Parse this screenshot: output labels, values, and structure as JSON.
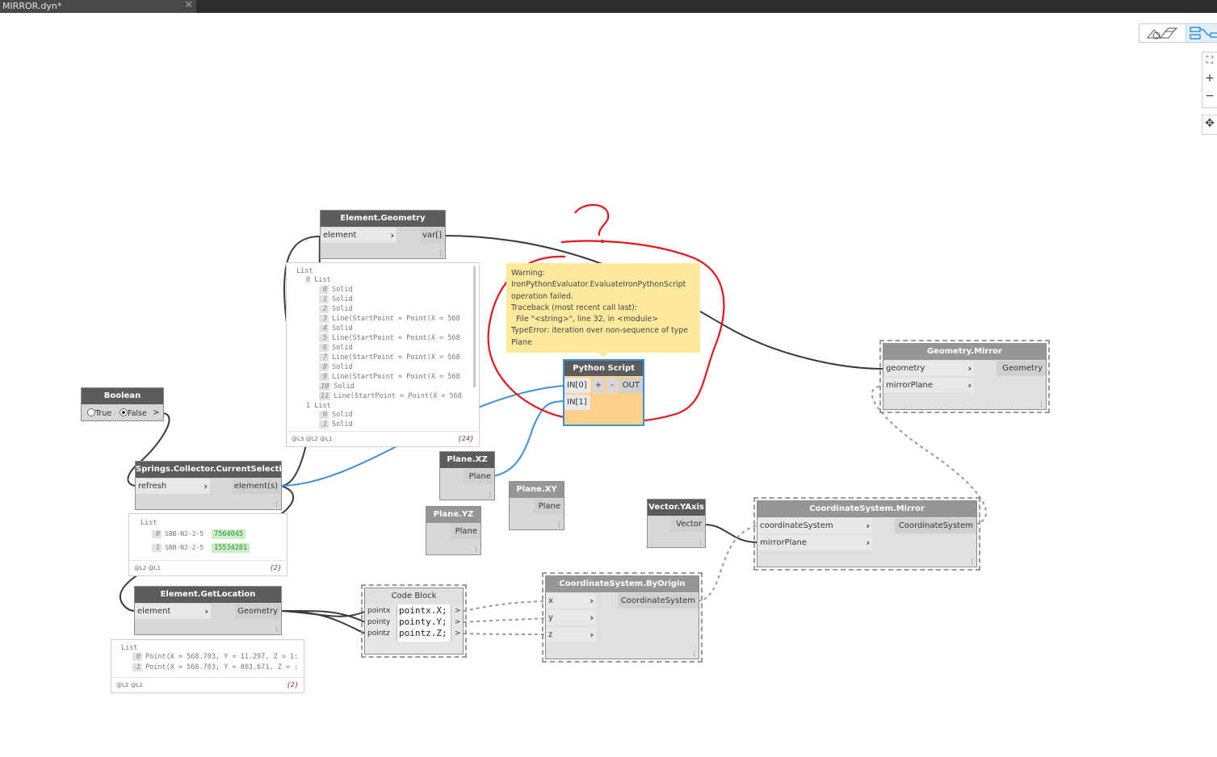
{
  "tab": {
    "title": "MIRROR.dyn*",
    "close": "✕"
  },
  "view_controls": {
    "nav": [
      "⛶",
      "+",
      "−",
      "✥"
    ]
  },
  "nodes": {
    "element_geometry": {
      "title": "Element.Geometry",
      "in": "element",
      "out": "var[]"
    },
    "boolean": {
      "title": "Boolean",
      "true_label": "True",
      "false_label": "False",
      "out": ">"
    },
    "current_selection": {
      "title": "Springs.Collector.CurrentSelection",
      "in": "refresh",
      "out": "element(s)"
    },
    "element_getlocation": {
      "title": "Element.GetLocation",
      "in": "element",
      "out": "Geometry"
    },
    "python_script": {
      "title": "Python Script",
      "in0": "IN[0]",
      "in1": "IN[1]",
      "plus": "+",
      "minus": "-",
      "out": "OUT"
    },
    "plane_xz": {
      "title": "Plane.XZ",
      "out": "Plane"
    },
    "plane_xy": {
      "title": "Plane.XY",
      "out": "Plane"
    },
    "plane_yz": {
      "title": "Plane.YZ",
      "out": "Plane"
    },
    "geometry_mirror": {
      "title": "Geometry.Mirror",
      "in0": "geometry",
      "in1": "mirrorPlane",
      "out": "Geometry"
    },
    "vector_yaxis": {
      "title": "Vector.YAxis",
      "out": "Vector"
    },
    "cs_mirror": {
      "title": "CoordinateSystem.Mirror",
      "in0": "coordinateSystem",
      "in1": "mirrorPlane",
      "out": "CoordinateSystem"
    },
    "code_block": {
      "title": "Code Block",
      "inputs": [
        "pointx",
        "pointy",
        "pointz"
      ],
      "lines": [
        "pointx.X;",
        "pointy.Y;",
        "pointz.Z;"
      ],
      "out": ">"
    },
    "cs_byorigin": {
      "title": "CoordinateSystem.ByOrigin",
      "inputs": [
        "x",
        "y",
        "z"
      ],
      "out": "CoordinateSystem"
    }
  },
  "previews": {
    "geometry": {
      "header": "List",
      "sub0": "0 List",
      "items": [
        {
          "i": "0",
          "v": "Solid"
        },
        {
          "i": "1",
          "v": "Solid"
        },
        {
          "i": "2",
          "v": "Solid"
        },
        {
          "i": "3",
          "v": "Line(StartPoint = Point(X = 568"
        },
        {
          "i": "4",
          "v": "Solid"
        },
        {
          "i": "5",
          "v": "Line(StartPoint = Point(X = 568"
        },
        {
          "i": "6",
          "v": "Solid"
        },
        {
          "i": "7",
          "v": "Line(StartPoint = Point(X = 568"
        },
        {
          "i": "8",
          "v": "Solid"
        },
        {
          "i": "9",
          "v": "Line(StartPoint = Point(X = 568"
        },
        {
          "i": "10",
          "v": "Solid"
        },
        {
          "i": "11",
          "v": "Line(StartPoint = Point(X = 568"
        }
      ],
      "sub1": "1 List",
      "items2": [
        {
          "i": "0",
          "v": "Solid"
        },
        {
          "i": "1",
          "v": "Solid"
        }
      ],
      "levels": "@L3 @L2 @L1",
      "count": "{24}"
    },
    "selection": {
      "header": "List",
      "items": [
        {
          "i": "0",
          "name": "SBB-N2-2-5",
          "id": "7564045"
        },
        {
          "i": "1",
          "name": "SBB-N2-2-5",
          "id": "15534281"
        }
      ],
      "levels": "@L2 @L1",
      "count": "{2}"
    },
    "location": {
      "header": "List",
      "items": [
        {
          "i": "0",
          "v": "Point(X = 568.703, Y = 11.297, Z = 1:"
        },
        {
          "i": "1",
          "v": "Point(X = 568.703, Y = 803.671, Z = :"
        }
      ],
      "levels": "@L2 @L1",
      "count": "{2}"
    }
  },
  "warning": {
    "lines": [
      "Warning:",
      "IronPythonEvaluator.EvaluateIronPythonScript",
      "operation failed.",
      "Traceback (most recent call last):",
      "  File \"<string>\", line 32, in <module>",
      "TypeError: iteration over non-sequence of type",
      "Plane"
    ]
  },
  "colors": {
    "annotation_red": "#e8141b",
    "warning_bg": "#fee99c",
    "python_body": "#fbd08a",
    "wire_blue": "#3d8fd6",
    "header_dark": "#5c5c5c"
  }
}
